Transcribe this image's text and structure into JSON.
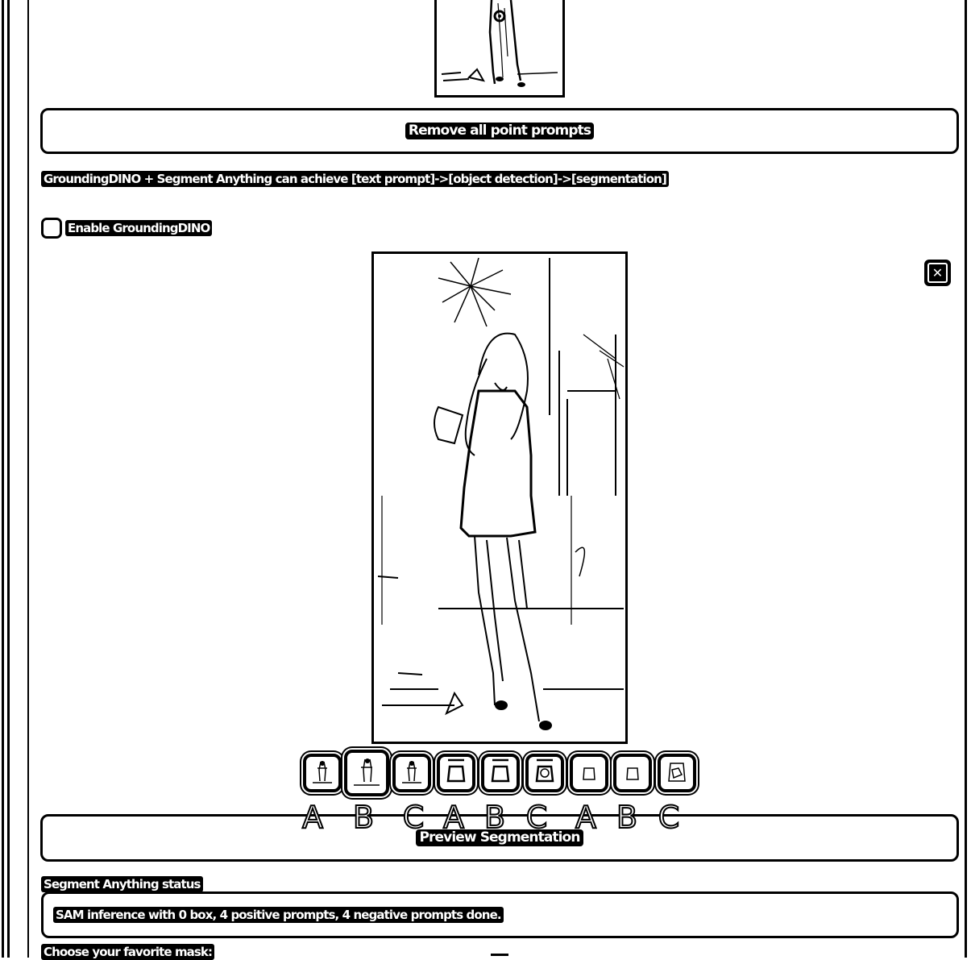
{
  "sam": {
    "remove_points_label": "Remove all point prompts",
    "dino_info": "GroundingDINO + Segment Anything can achieve [text prompt]->[object detection]->[segmentation]",
    "enable_dino_label": "Enable GroundingDINO",
    "enable_dino_checked": false,
    "close_icon_label": "✕",
    "preview_button_label": "Preview Segmentation",
    "status_label": "Segment Anything status",
    "status_text": "SAM inference with 0 box, 4 positive prompts, 4 negative prompts done.",
    "choose_mask_label": "Choose your favorite mask:"
  },
  "gallery": {
    "selected_index": 1,
    "items": [
      {
        "label": "A",
        "kind": "full"
      },
      {
        "label": "B",
        "kind": "full"
      },
      {
        "label": "C",
        "kind": "full"
      },
      {
        "label": "A",
        "kind": "mask"
      },
      {
        "label": "B",
        "kind": "mask"
      },
      {
        "label": "C",
        "kind": "mask"
      },
      {
        "label": "A",
        "kind": "crop"
      },
      {
        "label": "B",
        "kind": "crop"
      },
      {
        "label": "C",
        "kind": "crop"
      }
    ]
  },
  "colors": {
    "ink": "#000000",
    "paper": "#ffffff"
  }
}
